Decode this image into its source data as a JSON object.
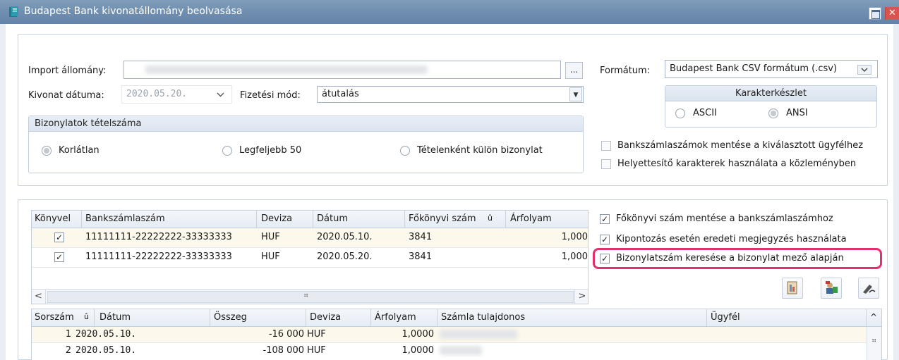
{
  "window": {
    "title": "Budapest Bank kivonatállomány beolvasása",
    "close_label": "✕"
  },
  "import": {
    "file_label": "Import állomány:",
    "browse_label": "...",
    "date_label": "Kivonat dátuma:",
    "date_value": "2020.05.20.",
    "payment_label": "Fizetési mód:",
    "payment_value": "átutalás",
    "format_label": "Formátum:",
    "format_value": "Budapest Bank CSV formátum (.csv)"
  },
  "charset": {
    "title": "Karakterkészlet",
    "options": [
      "ASCII",
      "ANSI"
    ],
    "selected": "ANSI"
  },
  "items_group": {
    "title": "Bizonylatok tételszáma",
    "options": [
      "Korlátlan",
      "Legfeljebb 50",
      "Tételenként külön bizonylat"
    ],
    "selected": "Korlátlan"
  },
  "options_top": [
    {
      "label": "Bankszámlaszámok mentése a kiválasztott ügyfélhez",
      "checked": false
    },
    {
      "label": "Helyettesítő karakterek használata a közleményben",
      "checked": false
    }
  ],
  "options_right": [
    {
      "label": "Főkönyvi szám mentése a bankszámlaszámhoz",
      "checked": true
    },
    {
      "label": "Kipontozás esetén eredeti megjegyzés használata",
      "checked": true
    },
    {
      "label": "Bizonylatszám keresése a bizonylat mező alapján",
      "checked": true,
      "highlight_color": "#e0316e"
    }
  ],
  "accounts_table": {
    "columns": [
      "Könyvel",
      "Bankszámlaszám",
      "Deviza",
      "Dátum",
      "Főkönyvi szám",
      "Árfolyam"
    ],
    "sort_marker": "û",
    "rows": [
      {
        "check": "✓",
        "account": "11111111-22222222-33333333",
        "currency": "HUF",
        "date": "2020.05.10.",
        "ledger": "3841",
        "rate": "1,000"
      },
      {
        "check": "✓",
        "account": "11111111-22222222-33333333",
        "currency": "HUF",
        "date": "2020.05.20.",
        "ledger": "3841",
        "rate": "1,000"
      }
    ],
    "scroll_left": "<",
    "scroll_right": ">",
    "grip": "⠶"
  },
  "transactions_table": {
    "columns": [
      "Sorszám",
      "Dátum",
      "Összeg",
      "Deviza",
      "Árfolyam",
      "Számla tulajdonos",
      "Ügyfél"
    ],
    "sort_marker": "û",
    "rows": [
      {
        "no": "1",
        "date": "2020.05.10.",
        "amount": "-16 000",
        "currency": "HUF",
        "rate": "1,0000"
      },
      {
        "no": "2",
        "date": "2020.05.10.",
        "amount": "-108 000",
        "currency": "HUF",
        "rate": "1,0000"
      }
    ],
    "scroll_up": "^",
    "grip": "⠶"
  },
  "colors": {
    "titlebar": "#6d8cae",
    "highlight": "#e0316e",
    "row_highlight": "#fdf8ec"
  }
}
